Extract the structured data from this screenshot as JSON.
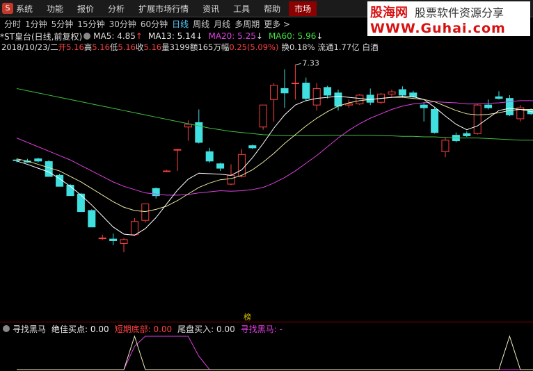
{
  "menu": {
    "items": [
      "系统",
      "功能",
      "报价",
      "分析",
      "扩展市场行情",
      "资讯",
      "工具",
      "帮助"
    ],
    "market": "市场"
  },
  "brand": {
    "name": "股海网",
    "tagline": "股票软件资源分享",
    "url": "WWW.Guhai.com"
  },
  "period_tabs": [
    "分时",
    "1分钟",
    "5分钟",
    "15分钟",
    "30分钟",
    "60分钟",
    "日线",
    "周线",
    "月线",
    "多周期",
    "更多 >"
  ],
  "active_tab": "日线",
  "stock": {
    "title": "*ST皇台(日线,前复权)",
    "ma5": "MA5: 4.85",
    "ma5_arrow": "↑",
    "ma13": "MA13: 5.14",
    "ma13_arrow": "↓",
    "ma20": "MA20: 5.25",
    "ma20_arrow": "↓",
    "ma60": "MA60: 5.96",
    "ma60_arrow": "↓"
  },
  "quote": {
    "date": "2018/10/23/二",
    "open_label": "开",
    "open": "5.16",
    "high_label": "高",
    "high": "5.16",
    "low_label": "低",
    "low": "5.16",
    "close_label": "收",
    "close": "5.16",
    "vol_label": "量",
    "vol": "3199",
    "amount_label": "额",
    "amount": "165万",
    "change_label": "幅",
    "change": "0.25(5.09%)",
    "turnover_label": "换",
    "turnover": "0.18%",
    "float_label": "流通",
    "float": "1.77亿",
    "sector": "白酒"
  },
  "annotations": {
    "high_mark": "7.33",
    "bang": "榜"
  },
  "indicator": {
    "name": "寻找黑马",
    "best_buy": "绝佳买点: 0.00",
    "short_bottom": "短期底部: 0.00",
    "tail_buy": "尾盘买入: 0.00",
    "black_horse": "寻找黑马: -"
  },
  "colors": {
    "up": "#ff4040",
    "down": "#40e0e0",
    "ma5": "#ffffff",
    "ma13": "#e8e8a0",
    "ma20": "#e040e0",
    "ma60": "#40c040"
  },
  "chart_data": {
    "type": "candlestick",
    "price_range": [
      3.2,
      7.5
    ],
    "candles": [
      {
        "o": 5.6,
        "h": 5.62,
        "l": 5.56,
        "c": 5.59
      },
      {
        "o": 5.58,
        "h": 5.62,
        "l": 5.55,
        "c": 5.56
      },
      {
        "o": 5.62,
        "h": 5.64,
        "l": 5.55,
        "c": 5.58
      },
      {
        "o": 5.57,
        "h": 5.6,
        "l": 5.3,
        "c": 5.3
      },
      {
        "o": 5.32,
        "h": 5.35,
        "l": 5.12,
        "c": 5.12
      },
      {
        "o": 5.14,
        "h": 5.16,
        "l": 4.95,
        "c": 4.95
      },
      {
        "o": 4.98,
        "h": 5.0,
        "l": 4.66,
        "c": 4.66
      },
      {
        "o": 4.68,
        "h": 4.7,
        "l": 4.38,
        "c": 4.38
      },
      {
        "o": 4.18,
        "h": 4.24,
        "l": 4.14,
        "c": 4.18
      },
      {
        "o": 4.16,
        "h": 4.26,
        "l": 4.05,
        "c": 4.13
      },
      {
        "o": 4.08,
        "h": 4.18,
        "l": 3.92,
        "c": 4.15
      },
      {
        "o": 4.24,
        "h": 4.54,
        "l": 4.22,
        "c": 4.48
      },
      {
        "o": 4.5,
        "h": 4.8,
        "l": 4.46,
        "c": 4.8
      },
      {
        "o": 5.08,
        "h": 5.1,
        "l": 4.9,
        "c": 4.95
      },
      {
        "o": 5.4,
        "h": 5.42,
        "l": 5.38,
        "c": 5.4
      },
      {
        "o": 5.79,
        "h": 5.8,
        "l": 5.4,
        "c": 5.79
      },
      {
        "o": 6.2,
        "h": 6.32,
        "l": 5.95,
        "c": 6.25
      },
      {
        "o": 6.28,
        "h": 6.52,
        "l": 5.9,
        "c": 5.92
      },
      {
        "o": 5.75,
        "h": 5.82,
        "l": 5.55,
        "c": 5.58
      },
      {
        "o": 5.53,
        "h": 5.55,
        "l": 5.4,
        "c": 5.45
      },
      {
        "o": 5.16,
        "h": 5.52,
        "l": 5.14,
        "c": 5.32
      },
      {
        "o": 5.3,
        "h": 5.8,
        "l": 5.28,
        "c": 5.7
      },
      {
        "o": 5.86,
        "h": 5.88,
        "l": 5.8,
        "c": 5.82
      },
      {
        "o": 6.2,
        "h": 6.6,
        "l": 6.15,
        "c": 6.6
      },
      {
        "o": 6.7,
        "h": 7.0,
        "l": 6.3,
        "c": 6.96
      },
      {
        "o": 6.9,
        "h": 7.25,
        "l": 6.55,
        "c": 6.82
      },
      {
        "o": 7.0,
        "h": 7.33,
        "l": 6.7,
        "c": 7.0
      },
      {
        "o": 7.0,
        "h": 7.1,
        "l": 6.68,
        "c": 6.72
      },
      {
        "o": 6.6,
        "h": 7.0,
        "l": 6.5,
        "c": 6.9
      },
      {
        "o": 6.92,
        "h": 6.95,
        "l": 6.72,
        "c": 6.78
      },
      {
        "o": 6.82,
        "h": 6.88,
        "l": 6.5,
        "c": 6.58
      },
      {
        "o": 6.6,
        "h": 6.7,
        "l": 6.55,
        "c": 6.62
      },
      {
        "o": 6.62,
        "h": 6.8,
        "l": 6.6,
        "c": 6.78
      },
      {
        "o": 6.78,
        "h": 6.9,
        "l": 6.6,
        "c": 6.65
      },
      {
        "o": 6.65,
        "h": 6.82,
        "l": 6.62,
        "c": 6.8
      },
      {
        "o": 6.8,
        "h": 6.88,
        "l": 6.75,
        "c": 6.84
      },
      {
        "o": 6.88,
        "h": 6.94,
        "l": 6.74,
        "c": 6.78
      },
      {
        "o": 6.82,
        "h": 6.86,
        "l": 6.72,
        "c": 6.75
      },
      {
        "o": 6.6,
        "h": 6.65,
        "l": 6.3,
        "c": 6.55
      },
      {
        "o": 6.52,
        "h": 6.55,
        "l": 6.08,
        "c": 6.1
      },
      {
        "o": 5.75,
        "h": 6.0,
        "l": 5.65,
        "c": 5.96
      },
      {
        "o": 6.05,
        "h": 6.1,
        "l": 5.92,
        "c": 5.95
      },
      {
        "o": 6.08,
        "h": 6.12,
        "l": 6.02,
        "c": 6.04
      },
      {
        "o": 6.08,
        "h": 6.62,
        "l": 6.06,
        "c": 6.6
      },
      {
        "o": 6.6,
        "h": 6.7,
        "l": 6.52,
        "c": 6.55
      },
      {
        "o": 6.75,
        "h": 6.85,
        "l": 6.7,
        "c": 6.72
      },
      {
        "o": 6.72,
        "h": 6.78,
        "l": 6.4,
        "c": 6.42
      },
      {
        "o": 6.35,
        "h": 6.6,
        "l": 6.3,
        "c": 6.55
      },
      {
        "o": 6.52,
        "h": 6.54,
        "l": 6.42,
        "c": 6.44
      },
      {
        "o": 6.42,
        "h": 6.5,
        "l": 6.34,
        "c": 6.36
      }
    ],
    "ma5": [
      5.58,
      5.52,
      5.45,
      5.38,
      5.26,
      5.12,
      4.96,
      4.78,
      4.58,
      4.38,
      4.25,
      4.23,
      4.35,
      4.55,
      4.8,
      5.05,
      5.25,
      5.36,
      5.35,
      5.34,
      5.32,
      5.42,
      5.64,
      5.9,
      6.18,
      6.42,
      6.6,
      6.68,
      6.72,
      6.74,
      6.76,
      6.74,
      6.72,
      6.7,
      6.72,
      6.74,
      6.76,
      6.75,
      6.7,
      6.56,
      6.4,
      6.25,
      6.15,
      6.22,
      6.36,
      6.5,
      6.54,
      6.52,
      6.48,
      6.45
    ],
    "ma13": [
      5.62,
      5.58,
      5.52,
      5.46,
      5.4,
      5.3,
      5.2,
      5.08,
      4.96,
      4.84,
      4.74,
      4.68,
      4.66,
      4.7,
      4.76,
      4.86,
      4.98,
      5.1,
      5.18,
      5.24,
      5.26,
      5.32,
      5.42,
      5.56,
      5.72,
      5.9,
      6.06,
      6.22,
      6.36,
      6.48,
      6.58,
      6.64,
      6.68,
      6.7,
      6.72,
      6.74,
      6.74,
      6.72,
      6.7,
      6.66,
      6.58,
      6.5,
      6.44,
      6.42,
      6.43,
      6.46,
      6.5,
      6.52,
      6.52,
      6.5
    ],
    "ma20": [
      6.0,
      5.92,
      5.84,
      5.76,
      5.68,
      5.6,
      5.5,
      5.4,
      5.3,
      5.2,
      5.12,
      5.06,
      5.0,
      4.98,
      4.96,
      4.96,
      4.97,
      5.0,
      5.02,
      5.04,
      5.03,
      5.04,
      5.06,
      5.1,
      5.18,
      5.28,
      5.4,
      5.54,
      5.68,
      5.84,
      6.0,
      6.14,
      6.26,
      6.36,
      6.44,
      6.52,
      6.58,
      6.62,
      6.64,
      6.66,
      6.65,
      6.64,
      6.62,
      6.62,
      6.63,
      6.64,
      6.66,
      6.68,
      6.68,
      6.66
    ],
    "ma60": [
      6.9,
      6.86,
      6.82,
      6.78,
      6.74,
      6.7,
      6.66,
      6.62,
      6.58,
      6.54,
      6.5,
      6.46,
      6.42,
      6.38,
      6.34,
      6.3,
      6.26,
      6.22,
      6.18,
      6.15,
      6.12,
      6.1,
      6.08,
      6.06,
      6.05,
      6.04,
      6.04,
      6.04,
      6.04,
      6.05,
      6.05,
      6.05,
      6.05,
      6.05,
      6.04,
      6.04,
      6.03,
      6.03,
      6.02,
      6.02,
      6.01,
      6.0,
      6.0,
      6.0,
      5.99,
      5.98,
      5.97,
      5.96,
      5.96,
      5.95
    ],
    "indicator_series": {
      "yellow": [
        0,
        0,
        0,
        0,
        0,
        0,
        0,
        0,
        0,
        0,
        0,
        1,
        0,
        0,
        0,
        0,
        0,
        0,
        0,
        0,
        0,
        0,
        0,
        0,
        0,
        0,
        0,
        0,
        0,
        0,
        0,
        0,
        0,
        0,
        0,
        0,
        0,
        0,
        0,
        0,
        0,
        0,
        0,
        0,
        0,
        0,
        1,
        0,
        0,
        0
      ],
      "magenta": [
        0,
        0,
        0,
        0,
        0,
        0,
        0,
        0,
        0,
        0,
        0,
        0.7,
        1,
        1,
        1,
        1,
        1,
        0.4,
        0,
        0,
        0,
        0,
        0,
        0,
        0,
        0,
        0,
        0,
        0,
        0,
        0,
        0,
        0,
        0,
        0,
        0,
        0,
        0,
        0,
        0,
        0,
        0,
        0,
        0,
        0,
        0,
        0,
        0,
        0,
        0
      ]
    }
  }
}
